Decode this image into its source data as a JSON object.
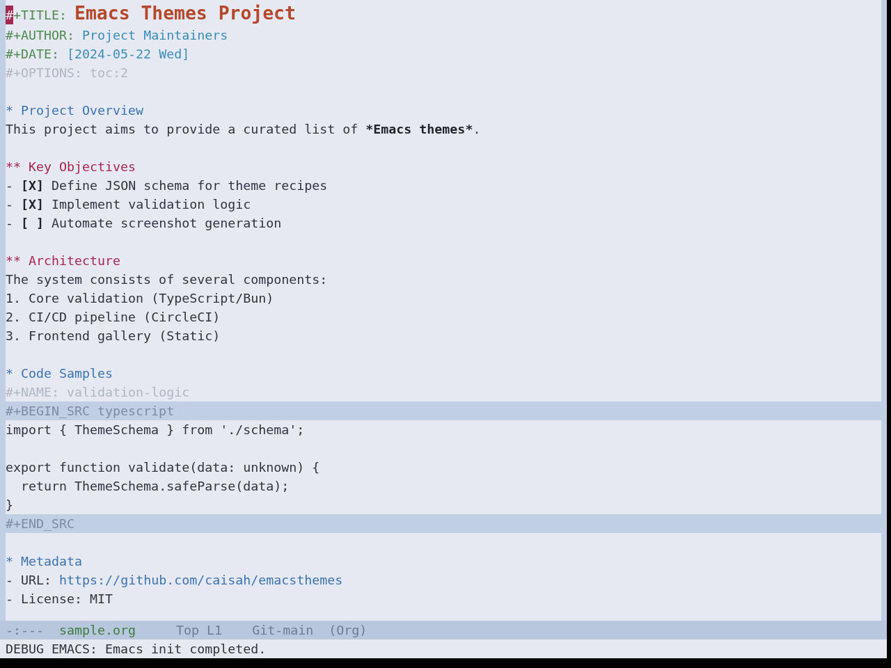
{
  "buffer": {
    "lines": [
      {
        "kind": "keyword_line",
        "segments": [
          {
            "kind": "cursor",
            "text": "#"
          },
          {
            "kind": "keyword",
            "text": "+TITLE:",
            "muted": false
          },
          {
            "kind": "title",
            "text": "Emacs Themes Project"
          }
        ]
      },
      {
        "kind": "keyword_line",
        "segments": [
          {
            "kind": "keyword",
            "text": "#+AUTHOR:",
            "muted": false
          },
          {
            "kind": "value",
            "text": "Project Maintainers",
            "muted": false
          }
        ]
      },
      {
        "kind": "keyword_line",
        "segments": [
          {
            "kind": "keyword",
            "text": "#+DATE:",
            "muted": false
          },
          {
            "kind": "value",
            "text": "[2024-05-22 Wed]",
            "muted": false
          }
        ]
      },
      {
        "kind": "keyword_line",
        "segments": [
          {
            "kind": "keyword",
            "text": "#+OPTIONS:",
            "muted": true
          },
          {
            "kind": "value",
            "text": "toc:2",
            "muted": true
          }
        ]
      },
      {
        "kind": "blank"
      },
      {
        "kind": "heading",
        "stars": "*",
        "title": "Project Overview"
      },
      {
        "kind": "paragraph",
        "runs": [
          {
            "text": "This project aims to provide a curated list of ",
            "bold": false
          },
          {
            "text": "*Emacs themes*",
            "bold": true
          },
          {
            "text": ".",
            "bold": false
          }
        ]
      },
      {
        "kind": "blank"
      },
      {
        "kind": "heading",
        "stars": "**",
        "title": "Key Objectives"
      },
      {
        "kind": "checklist_item",
        "bullet": "-",
        "box": "[X]",
        "text": "Define JSON schema for theme recipes"
      },
      {
        "kind": "checklist_item",
        "bullet": "-",
        "box": "[X]",
        "text": "Implement validation logic"
      },
      {
        "kind": "checklist_item",
        "bullet": "-",
        "box": "[ ]",
        "text": "Automate screenshot generation"
      },
      {
        "kind": "blank"
      },
      {
        "kind": "heading",
        "stars": "**",
        "title": "Architecture"
      },
      {
        "kind": "paragraph",
        "runs": [
          {
            "text": "The system consists of several components:",
            "bold": false
          }
        ]
      },
      {
        "kind": "list_item",
        "bullet": "1.",
        "text": "Core validation (TypeScript/Bun)"
      },
      {
        "kind": "list_item",
        "bullet": "2.",
        "text": "CI/CD pipeline (CircleCI)"
      },
      {
        "kind": "list_item",
        "bullet": "3.",
        "text": "Frontend gallery (Static)"
      },
      {
        "kind": "blank"
      },
      {
        "kind": "heading",
        "stars": "*",
        "title": "Code Samples"
      },
      {
        "kind": "keyword_line",
        "segments": [
          {
            "kind": "keyword",
            "text": "#+NAME:",
            "muted": true
          },
          {
            "kind": "value",
            "text": "validation-logic",
            "muted": true
          }
        ]
      },
      {
        "kind": "block_delimiter",
        "text": "#+BEGIN_SRC typescript"
      },
      {
        "kind": "code",
        "text": "import { ThemeSchema } from './schema';"
      },
      {
        "kind": "blank"
      },
      {
        "kind": "code",
        "text": "export function validate(data: unknown) {"
      },
      {
        "kind": "code",
        "text": "  return ThemeSchema.safeParse(data);"
      },
      {
        "kind": "code",
        "text": "}"
      },
      {
        "kind": "block_delimiter",
        "text": "#+END_SRC"
      },
      {
        "kind": "blank"
      },
      {
        "kind": "heading",
        "stars": "*",
        "title": "Metadata"
      },
      {
        "kind": "list_item",
        "bullet": "-",
        "label": "URL:",
        "link": "https://github.com/caisah/emacsthemes"
      },
      {
        "kind": "list_item",
        "bullet": "-",
        "text": "License: MIT"
      }
    ]
  },
  "mode_line": {
    "segments": [
      {
        "kind": "status",
        "text": "-:---"
      },
      {
        "kind": "buffer_name",
        "text": "sample.org"
      },
      {
        "kind": "position",
        "text": "Top L1"
      },
      {
        "kind": "vc",
        "text": "Git-main"
      },
      {
        "kind": "mode",
        "text": "(Org)"
      }
    ]
  },
  "echo_area": {
    "message": "DEBUG EMACS: Emacs init completed."
  }
}
